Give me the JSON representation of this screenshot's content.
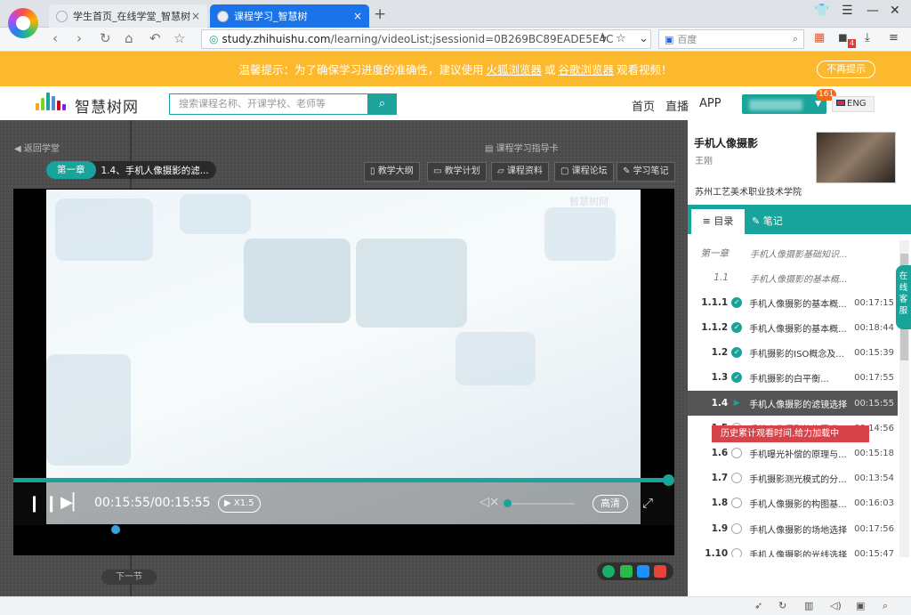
{
  "browser": {
    "tabs": [
      {
        "label": "学生首页_在线学堂_智慧树",
        "close": "×"
      },
      {
        "label": "课程学习_智慧树",
        "close": "×"
      }
    ],
    "new_tab": "+",
    "url_host": "study.zhihuishu.com",
    "url_path": "/learning/videoList;jsessionid=0B269BC89EADE5E4C",
    "search_placeholder": "百度",
    "extension_badge": "4"
  },
  "notice": {
    "prefix": "温馨提示：为了确保学习进度的准确性，建议使用",
    "link1": "火狐浏览器",
    "or": "或",
    "link2": "谷歌浏览器",
    "suffix": "观看视频！",
    "dismiss": "不再提示"
  },
  "header": {
    "logo_text": "智慧树网",
    "search_placeholder": "搜索课程名称、开课学校、老师等",
    "nav": [
      "首页",
      "直播",
      "APP"
    ],
    "user_badge": "161",
    "lang": "ENG"
  },
  "player": {
    "back": "返回学堂",
    "guide": "课程学习指导卡",
    "chapter_tag": "第一章",
    "current_lesson": "1.4、手机人像摄影的滤...",
    "tools": [
      "教学大纲",
      "教学计划",
      "课程资料",
      "课程论坛",
      "学习笔记"
    ],
    "watermark": "智慧树网",
    "time": "00:15:55/00:15:55",
    "speed": "X1.5",
    "quality": "高清",
    "progress": 1.0,
    "volume": 0.0,
    "next": "下一节"
  },
  "course": {
    "title": "手机人像摄影",
    "teacher": "王刚",
    "school": "苏州工艺美术职业技术学院",
    "tab_catalog": "目录",
    "tab_notes": "笔记"
  },
  "catalog": [
    {
      "num": "第一章",
      "title": "手机人像摄影基础知识...",
      "dur": "",
      "status": "chapter"
    },
    {
      "num": "1.1",
      "title": "手机人像摄影的基本概...",
      "dur": "",
      "status": "chapter"
    },
    {
      "num": "1.1.1",
      "title": "手机人像摄影的基本概...",
      "dur": "00:17:15",
      "status": "done"
    },
    {
      "num": "1.1.2",
      "title": "手机人像摄影的基本概...",
      "dur": "00:18:44",
      "status": "done"
    },
    {
      "num": "1.2",
      "title": "手机摄影的ISO概念及...",
      "dur": "00:15:39",
      "status": "done"
    },
    {
      "num": "1.3",
      "title": "手机摄影的白平衡...",
      "dur": "00:17:55",
      "status": "done"
    },
    {
      "num": "1.4",
      "title": "手机人像摄影的滤镜选择",
      "dur": "00:15:55",
      "status": "play"
    },
    {
      "num": "1.5",
      "title": "手机人像摄影的构图运用",
      "dur": "00:14:56",
      "status": "todo"
    },
    {
      "num": "1.6",
      "title": "手机曝光补偿的原理与...",
      "dur": "00:15:18",
      "status": "todo"
    },
    {
      "num": "1.7",
      "title": "手机摄影测光模式的分...",
      "dur": "00:13:54",
      "status": "todo"
    },
    {
      "num": "1.8",
      "title": "手机人像摄影的构图基...",
      "dur": "00:16:03",
      "status": "todo"
    },
    {
      "num": "1.9",
      "title": "手机人像摄影的场地选择",
      "dur": "00:17:56",
      "status": "todo"
    },
    {
      "num": "1.10",
      "title": "手机人像摄影的光线选择",
      "dur": "00:15:47",
      "status": "todo"
    }
  ],
  "tooltip": "历史累计观看时间,给力加载中",
  "service": "在线客服",
  "icons": {
    "play": "play-icon",
    "pause": "pause-icon",
    "mute": "mute-icon",
    "fullscreen": "fullscreen-icon",
    "search": "search-icon",
    "check": "check-icon"
  },
  "colors": {
    "accent": "#18a39b",
    "notice": "#fdb92d",
    "tab_active": "#1a73e8",
    "tooltip": "#d6444a"
  }
}
